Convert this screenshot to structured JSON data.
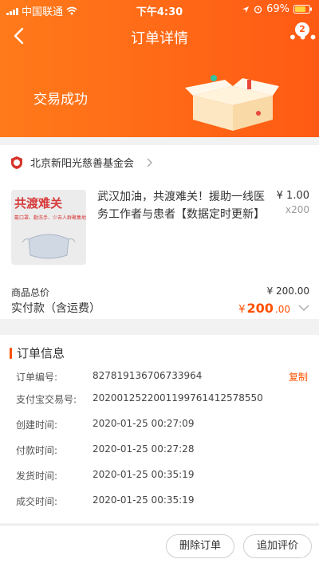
{
  "status_bar": {
    "carrier": "中国联通",
    "time": "下午4:30",
    "battery": "69%"
  },
  "nav": {
    "title": "订单详情",
    "badge_count": "2"
  },
  "order_status": "交易成功",
  "shop": {
    "name": "北京新阳光慈善基金会"
  },
  "product": {
    "image_title": "共渡难关",
    "image_subtitle": "戴口罩、勤洗手、少去人群聚集地",
    "title": "武汉加油，共渡难关！援助一线医务工作者与患者【数据定时更新】",
    "price": "¥ 1.00",
    "quantity": "x200"
  },
  "summary": {
    "total_label": "商品总价",
    "total_value": "¥ 200.00",
    "paid_label": "实付款（含运费）",
    "paid_currency": "¥",
    "paid_int": "200",
    "paid_dec": ".00"
  },
  "order_info": {
    "title": "订单信息",
    "copy_label": "复制",
    "rows": [
      {
        "label": "订单编号:",
        "value": "827819136706733964"
      },
      {
        "label": "支付宝交易号:",
        "value": "2020012522001199761412578550"
      },
      {
        "label": "创建时间:",
        "value": "2020-01-25 00:27:09"
      },
      {
        "label": "付款时间:",
        "value": "2020-01-25 00:27:28"
      },
      {
        "label": "发货时间:",
        "value": "2020-01-25 00:35:19"
      },
      {
        "label": "成交时间:",
        "value": "2020-01-25 00:35:19"
      }
    ]
  },
  "actions": {
    "delete_label": "删除订单",
    "review_label": "追加评价"
  },
  "colors": {
    "header_start": "#ff7a1a",
    "header_end": "#ff5a14",
    "accent": "#ff5000"
  },
  "icons": {
    "back": "chevron-left-icon",
    "more": "more-dots-icon",
    "shop_logo": "shop-logo-icon",
    "shop_arrow": "chevron-right-icon",
    "expand": "chevron-down-icon"
  }
}
